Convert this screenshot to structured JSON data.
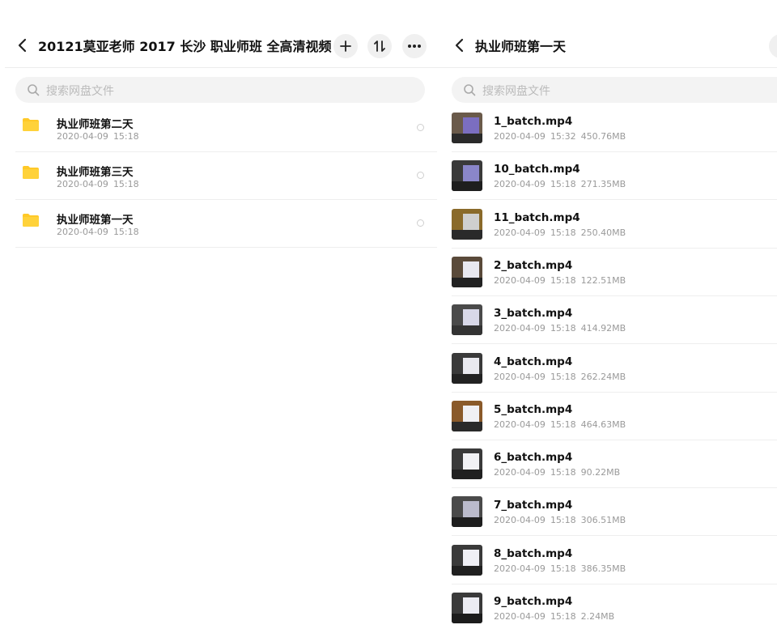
{
  "left": {
    "title": "20121莫亚老师  2017 长沙 职业师班 全高清视频",
    "search_placeholder": "搜索网盘文件",
    "buttons": {
      "add": "+",
      "sort": "⇅",
      "more": "•••"
    },
    "folders": [
      {
        "name": "执业师班第二天",
        "date": "2020-04-09",
        "time": "15:18"
      },
      {
        "name": "执业师班第三天",
        "date": "2020-04-09",
        "time": "15:18"
      },
      {
        "name": "执业师班第一天",
        "date": "2020-04-09",
        "time": "15:18"
      }
    ]
  },
  "right": {
    "title": "执业师班第一天",
    "search_placeholder": "搜索网盘文件",
    "files": [
      {
        "name": "1_batch.mp4",
        "date": "2020-04-09",
        "time": "15:32",
        "size": "450.76MB"
      },
      {
        "name": "10_batch.mp4",
        "date": "2020-04-09",
        "time": "15:18",
        "size": "271.35MB"
      },
      {
        "name": "11_batch.mp4",
        "date": "2020-04-09",
        "time": "15:18",
        "size": "250.40MB"
      },
      {
        "name": "2_batch.mp4",
        "date": "2020-04-09",
        "time": "15:18",
        "size": "122.51MB"
      },
      {
        "name": "3_batch.mp4",
        "date": "2020-04-09",
        "time": "15:18",
        "size": "414.92MB"
      },
      {
        "name": "4_batch.mp4",
        "date": "2020-04-09",
        "time": "15:18",
        "size": "262.24MB"
      },
      {
        "name": "5_batch.mp4",
        "date": "2020-04-09",
        "time": "15:18",
        "size": "464.63MB"
      },
      {
        "name": "6_batch.mp4",
        "date": "2020-04-09",
        "time": "15:18",
        "size": "90.22MB"
      },
      {
        "name": "7_batch.mp4",
        "date": "2020-04-09",
        "time": "15:18",
        "size": "306.51MB"
      },
      {
        "name": "8_batch.mp4",
        "date": "2020-04-09",
        "time": "15:18",
        "size": "386.35MB"
      },
      {
        "name": "9_batch.mp4",
        "date": "2020-04-09",
        "time": "15:18",
        "size": "2.24MB"
      }
    ]
  },
  "colors": {
    "folder": "#ffc928",
    "divider": "#eeeeee",
    "search_bg": "#f3f3f3",
    "meta_text": "#9a9a9a"
  },
  "icons": {
    "back": "chevron-left-icon",
    "search": "search-icon",
    "folder": "folder-icon",
    "select": "radio-circle-icon"
  }
}
